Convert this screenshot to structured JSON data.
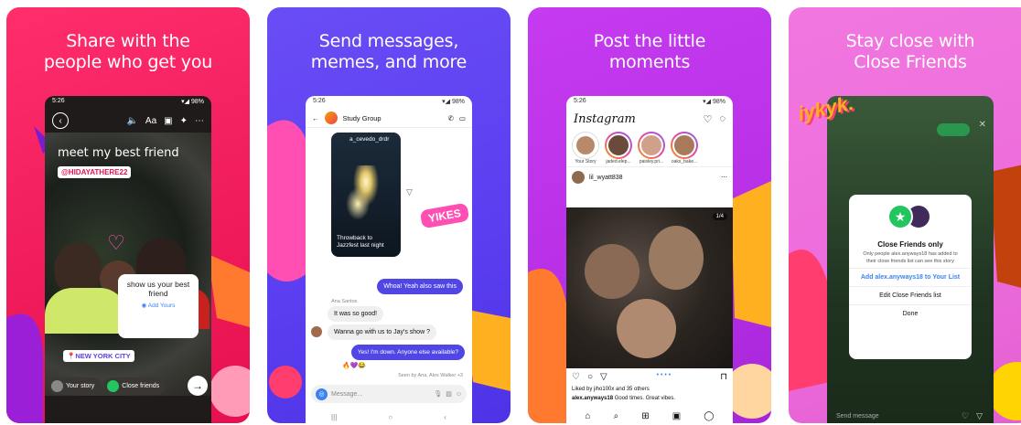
{
  "colors": {
    "card1": "#f01c5c",
    "card2": "#5a3ef0",
    "card3": "#b72fe6",
    "card4": "#ec6cdb",
    "accent_blue": "#3b82f6",
    "close_friends_green": "#22c55e"
  },
  "card1": {
    "headline_1": "Share with the",
    "headline_2": "people who get you",
    "status_time": "5:26",
    "status_right": "▾◢ 98%",
    "toolbar_icons": [
      "back-icon",
      "sound-icon",
      "text-icon",
      "sticker-icon",
      "effects-icon",
      "more-icon"
    ],
    "text_label": "Aa",
    "caption": "meet my best friend",
    "mention": "@HIDAYATHERE22",
    "sticker_text": "show us your best friend",
    "sticker_add": "Add Yours",
    "location": "NEW YORK CITY",
    "your_story": "Your story",
    "close_friends": "Close friends"
  },
  "card2": {
    "headline_1": "Send messages,",
    "headline_2": "memes, and more",
    "status_time": "5:26",
    "status_right": "▾◢ 98%",
    "group_name": "Study Group",
    "reel_user": "a_cevedo_drdr",
    "reel_caption_1": "Throwback to",
    "reel_caption_2": "Jazzfest last night",
    "msg_out_1": "Whoa! Yeah also saw this",
    "sender_name": "Ana Santos",
    "msg_in_1": "It was so good!",
    "msg_in_2": "Wanna go with us to Jay's show ?",
    "msg_out_2": "Yes! I'm down. Anyone else available?",
    "reactions": "🔥💜😂",
    "seen_by": "Seen by Ana, Alex Walker +3",
    "message_placeholder": "Message...",
    "sticker_text": "YIKES"
  },
  "card3": {
    "headline_1": "Post the little",
    "headline_2": "moments",
    "status_time": "5:26",
    "status_right": "▾◢ 98%",
    "logo": "Instagram",
    "stories": [
      "Your Story",
      "jaded.elep...",
      "paisley.pri...",
      "oaks_bake..."
    ],
    "post_user": "lil_wyatt838",
    "image_counter": "1/4",
    "likes_text": "Liked by jiho100x and 35 others",
    "caption_user": "alex.anyways18",
    "caption_text": "Good times. Great vibes."
  },
  "card4": {
    "headline_1": "Stay close with",
    "headline_2": "Close Friends",
    "sticker_text": "iykyk.",
    "modal_title": "Close Friends only",
    "modal_body": "Only people alex.anyways18 has added to their close friends list can see this story",
    "add_option": "Add alex.anyways18 to Your List",
    "edit_option": "Edit Close Friends list",
    "done_option": "Done",
    "send_placeholder": "Send message"
  }
}
